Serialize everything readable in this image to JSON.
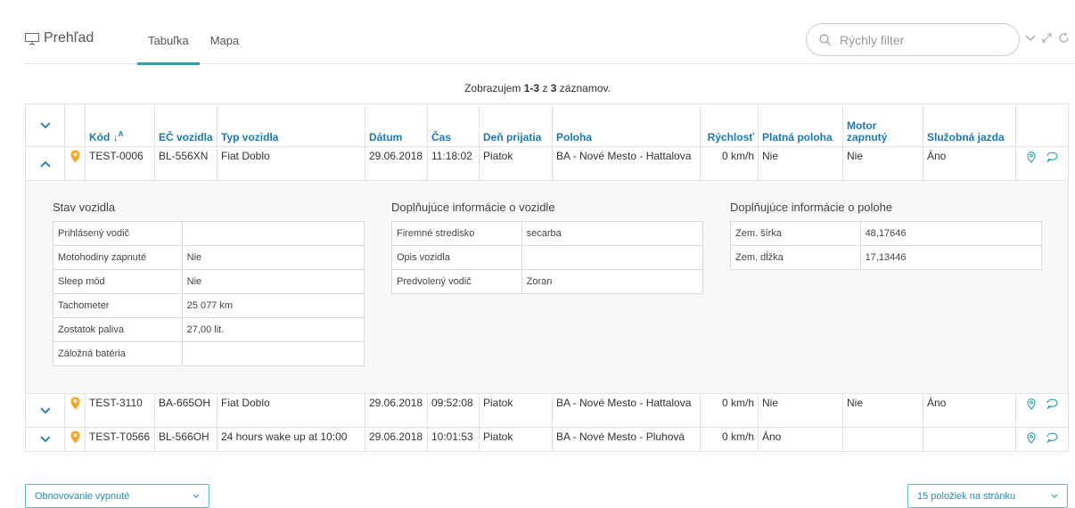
{
  "header": {
    "title": "Prehľad",
    "tabs": [
      {
        "label": "Tabuľka",
        "active": true
      },
      {
        "label": "Mapa",
        "active": false
      }
    ],
    "filter_placeholder": "Rýchly filter"
  },
  "summary": {
    "prefix": "Zobrazujem ",
    "range": "1-3",
    "middle": " z ",
    "total": "3",
    "suffix": " záznamov."
  },
  "table": {
    "columns": [
      "Kód",
      "EČ vozidla",
      "Typ vozidla",
      "Dátum",
      "Čas",
      "Deň prijatia",
      "Poloha",
      "Rýchlosť",
      "Platná poloha",
      "Motor zapnutý",
      "Služobná jazda"
    ],
    "rows": [
      {
        "kod": "TEST-0006",
        "ec": "BL-556XN",
        "typ": "Fiat Doblo",
        "datum": "29.06.2018",
        "cas": "11:18:02",
        "den": "Piatok",
        "poloha": "BA - Nové Mesto - Hattalova",
        "rychlost": "0 km/h",
        "platna": "Nie",
        "motor": "Nie",
        "sluzobna": "Áno",
        "expanded": true
      },
      {
        "kod": "TEST-3110",
        "ec": "BA-665OH",
        "typ": "Fiat Doblo",
        "datum": "29.06.2018",
        "cas": "09:52:08",
        "den": "Piatok",
        "poloha": "BA - Nové Mesto - Hattalova",
        "rychlost": "0 km/h",
        "platna": "Nie",
        "motor": "Nie",
        "sluzobna": "Áno"
      },
      {
        "kod": "TEST-T0566",
        "ec": "BL-566OH",
        "typ": "24 hours wake up at 10:00",
        "datum": "29.06.2018",
        "cas": "10:01:53",
        "den": "Piatok",
        "poloha": "BA - Nové Mesto - Pluhová",
        "rychlost": "0 km/h",
        "platna": "Áno",
        "motor": "",
        "sluzobna": ""
      }
    ]
  },
  "detail": {
    "stav": {
      "title": "Stav vozidla",
      "items": [
        {
          "label": "Prihlásený vodič",
          "value": ""
        },
        {
          "label": "Motohodiny zapnuté",
          "value": "Nie"
        },
        {
          "label": "Sleep mód",
          "value": "Nie"
        },
        {
          "label": "Tachometer",
          "value": "25 077 km"
        },
        {
          "label": "Zostatok paliva",
          "value": "27,00 lit."
        },
        {
          "label": "Záložná batéria",
          "value": ""
        }
      ]
    },
    "vozidlo": {
      "title": "Doplňujúce informácie o vozidle",
      "items": [
        {
          "label": "Firemné stredisko",
          "value": "secarba"
        },
        {
          "label": "Opis vozidla",
          "value": ""
        },
        {
          "label": "Predvolený vodič",
          "value": "Zoran"
        }
      ]
    },
    "poloha": {
      "title": "Doplňujúce informácie o polohe",
      "items": [
        {
          "label": "Zem. šírka",
          "value": "48,17646"
        },
        {
          "label": "Zem. dĺžka",
          "value": "17,13446"
        }
      ]
    }
  },
  "footer": {
    "refresh_label": "Obnovovanie vypnuté",
    "per_page_label": "15 položiek na stránku"
  },
  "colors": {
    "accent": "#27a1a5",
    "header_text": "#1b7ab5",
    "pin": "#f5a623"
  }
}
